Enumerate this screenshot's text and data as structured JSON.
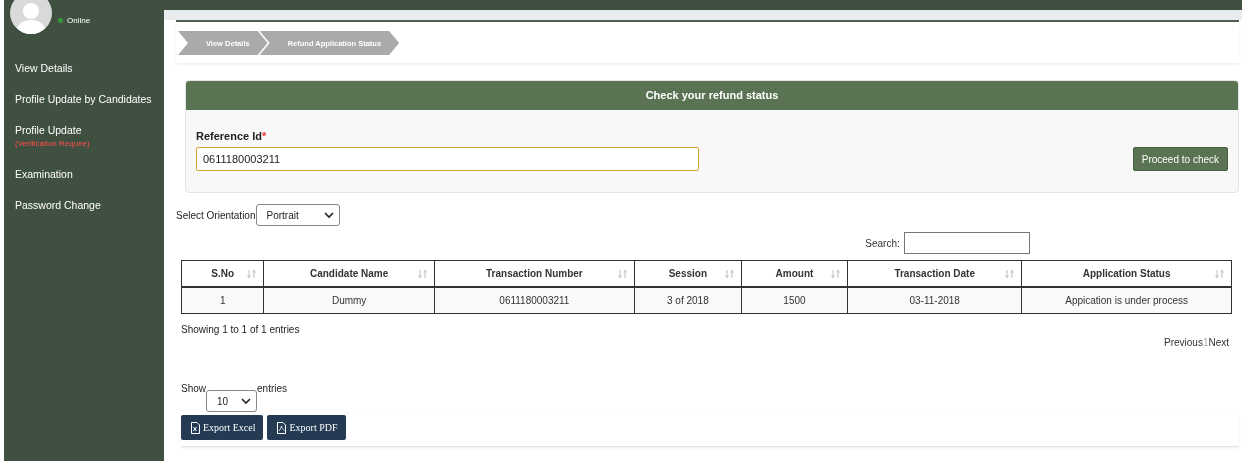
{
  "sidebar": {
    "user_status": "Online",
    "items": [
      {
        "label": "View Details"
      },
      {
        "label": "Profile Update by Candidates"
      },
      {
        "label": "Profile Update",
        "note": "(Verification Require)"
      },
      {
        "label": "Examination"
      },
      {
        "label": "Password Change"
      }
    ]
  },
  "breadcrumb": [
    "View Details",
    "Refund Application Status"
  ],
  "refund_form": {
    "title": "Check your refund status",
    "field_label": "Reference Id",
    "required_mark": "*",
    "value": "0611180003211",
    "button": "Proceed to check"
  },
  "orientation": {
    "label": "Select Orientation",
    "value": "Portrait"
  },
  "search": {
    "label": "Search:"
  },
  "table": {
    "columns": [
      "S.No",
      "Candidate Name",
      "Transaction Number",
      "Session",
      "Amount",
      "Transaction Date",
      "Application Status"
    ],
    "rows": [
      [
        "1",
        "Dummy",
        "0611180003211",
        "3 of 2018",
        "1500",
        "03-11-2018",
        "Appication is under process"
      ]
    ]
  },
  "info": "Showing 1 to 1 of 1 entries",
  "pagination": {
    "previous": "Previous",
    "pages": [
      {
        "label": "1",
        "selected": true
      }
    ],
    "next": "Next"
  },
  "length": {
    "prefix": "Show",
    "value": "10",
    "suffix": "entries"
  },
  "export_buttons": [
    {
      "kind": "excel",
      "label": "Export Excel"
    },
    {
      "kind": "pdf",
      "label": "Export PDF"
    }
  ]
}
